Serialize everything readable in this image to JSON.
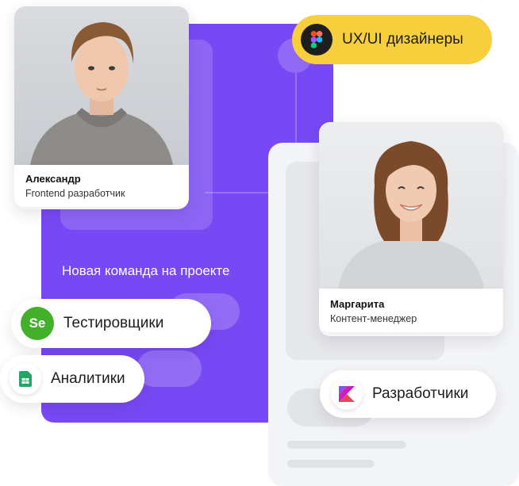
{
  "team_banner": "Новая команда на проекте",
  "people": [
    {
      "name": "Александр",
      "role": "Frontend разработчик"
    },
    {
      "name": "Маргарита",
      "role": "Контент-менеджер"
    }
  ],
  "pills": {
    "designers": {
      "label": "UX/UI дизайнеры",
      "icon": "figma-icon"
    },
    "testers": {
      "label": "Тестировщики",
      "icon": "selenium-icon",
      "icon_text": "Se"
    },
    "analysts": {
      "label": "Аналитики",
      "icon": "google-sheets-icon"
    },
    "developers": {
      "label": "Разработчики",
      "icon": "kotlin-icon"
    }
  },
  "colors": {
    "purple": "#7848f4",
    "yellow": "#f7cf3d",
    "selenium_green": "#43b02a",
    "sheets_green": "#23a566"
  }
}
